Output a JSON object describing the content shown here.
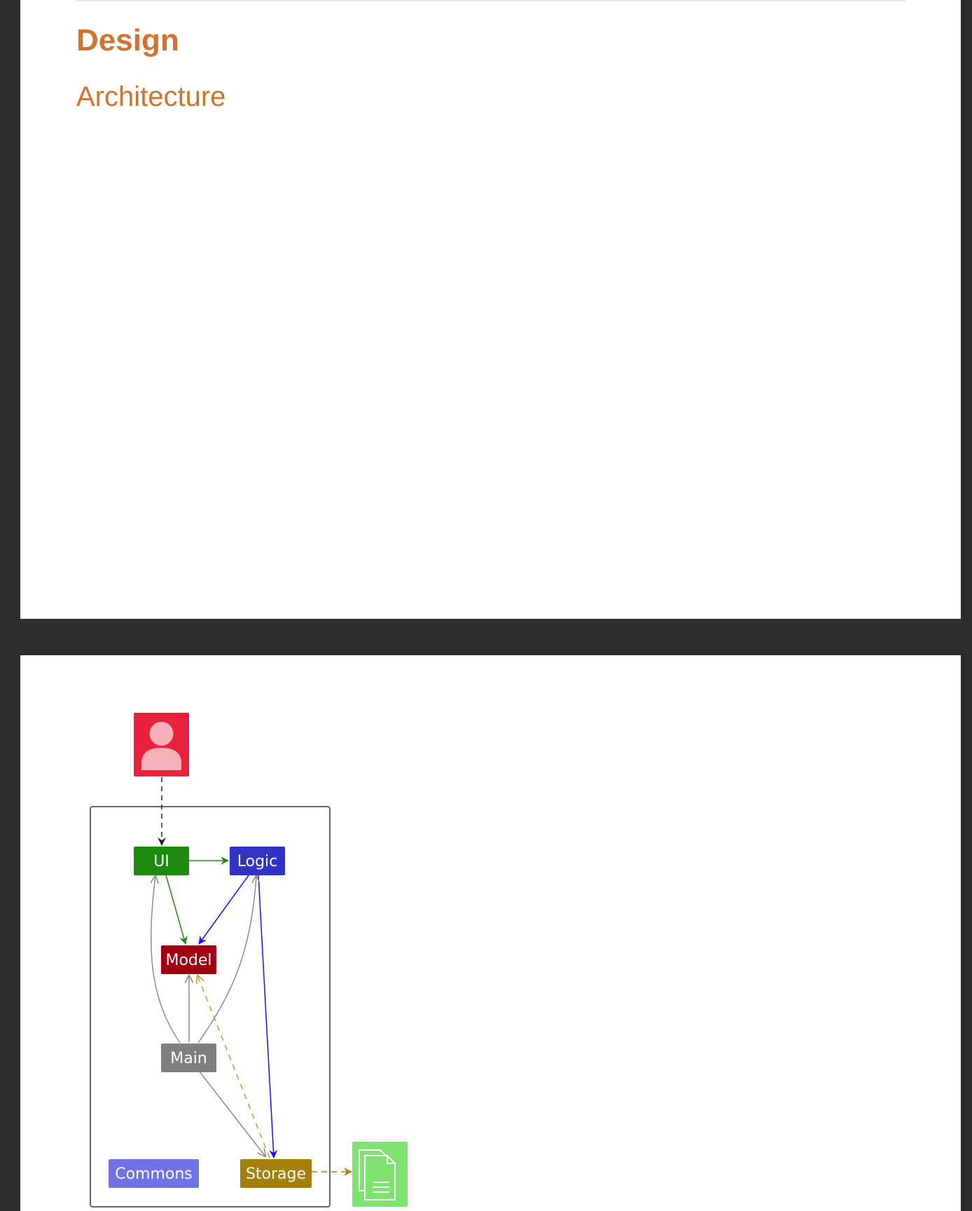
{
  "document": {
    "section_title": "Design",
    "subsection_title": "Architecture"
  },
  "diagram": {
    "nodes": {
      "ui": "UI",
      "logic": "Logic",
      "model": "Model",
      "main": "Main",
      "commons": "Commons",
      "storage": "Storage"
    },
    "colors": {
      "ui": "#1f8b0e",
      "logic": "#3033c4",
      "model": "#a20011",
      "main": "#7f7f7f",
      "commons": "#7272e8",
      "storage": "#a4800a",
      "user_icon": "#e9213b",
      "file_icon": "#7fe36f"
    },
    "icons": {
      "user": "user-icon",
      "file": "file-icon"
    }
  }
}
